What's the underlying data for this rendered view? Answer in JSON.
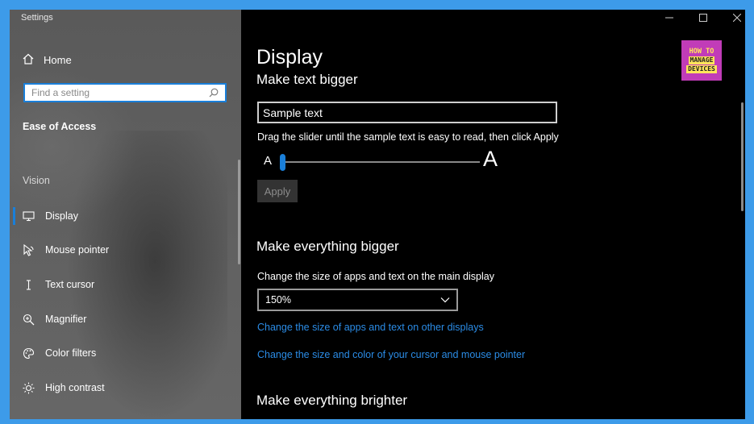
{
  "window": {
    "title": "Settings",
    "accent": "#1a7fd9"
  },
  "sidebar": {
    "home_label": "Home",
    "search_placeholder": "Find a setting",
    "category": "Ease of Access",
    "section": "Vision",
    "items": [
      {
        "label": "Display",
        "icon": "monitor-icon",
        "active": true
      },
      {
        "label": "Mouse pointer",
        "icon": "mouse-pointer-icon"
      },
      {
        "label": "Text cursor",
        "icon": "text-cursor-icon"
      },
      {
        "label": "Magnifier",
        "icon": "magnifier-icon"
      },
      {
        "label": "Color filters",
        "icon": "palette-icon"
      },
      {
        "label": "High contrast",
        "icon": "sun-icon"
      }
    ]
  },
  "main": {
    "title": "Display",
    "logo": {
      "line1": "HOW TO",
      "line2": "MANAGE",
      "line3": "DEVICES"
    },
    "text_bigger": {
      "heading": "Make text bigger",
      "sample_value": "Sample text",
      "instruction": "Drag the slider until the sample text is easy to read, then click Apply",
      "small_a": "A",
      "big_a": "A",
      "slider_value_percent": 0,
      "apply_label": "Apply"
    },
    "everything_bigger": {
      "heading": "Make everything bigger",
      "description": "Change the size of apps and text on the main display",
      "scale_value": "150%",
      "link_other_displays": "Change the size of apps and text on other displays",
      "link_cursor": "Change the size and color of your cursor and mouse pointer"
    },
    "brighter": {
      "heading": "Make everything brighter"
    }
  }
}
